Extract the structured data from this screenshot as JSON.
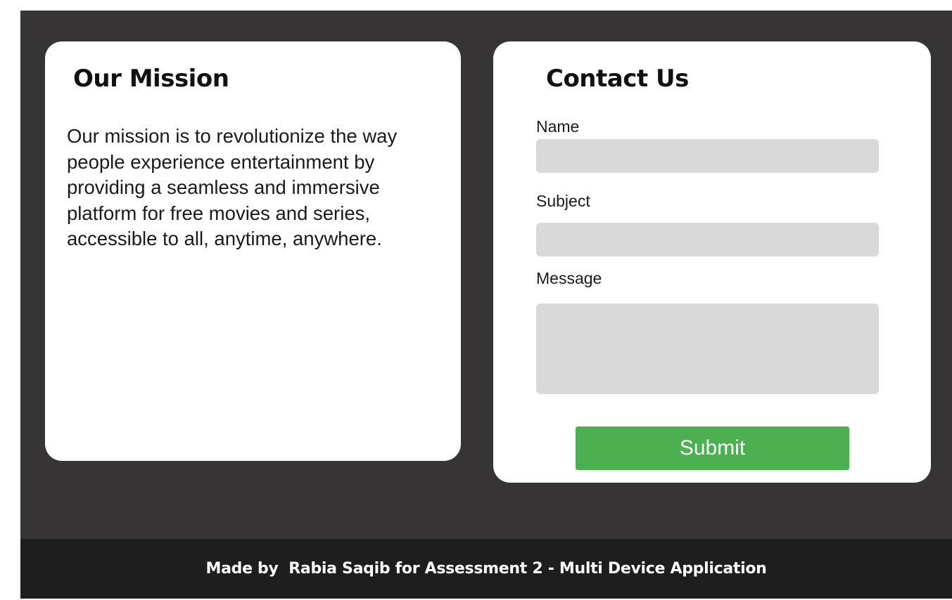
{
  "mission": {
    "title": "Our Mission",
    "body": "Our mission is to revolutionize the way people experience entertainment by providing a seamless and immersive platform for free movies and series, accessible to all, anytime, anywhere."
  },
  "contact": {
    "title": "Contact Us",
    "name_label": "Name",
    "name_value": "",
    "subject_label": "Subject",
    "subject_value": "",
    "message_label": "Message",
    "message_value": "",
    "submit_label": "Submit"
  },
  "footer": {
    "text": "Made by  Rabia Saqib for Assessment 2 - Multi Device Application"
  },
  "colors": {
    "page_background": "#363435",
    "card_background": "#ffffff",
    "field_background": "#d9d9d9",
    "submit_button": "#4caf50",
    "footer_background": "#1e1e1e"
  }
}
